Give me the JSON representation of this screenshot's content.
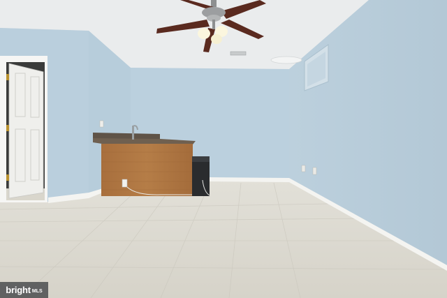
{
  "photo": {
    "colors": {
      "wall": "#b9cfdd",
      "ceiling": "#e9ecec",
      "floor": "#d8d6cc",
      "door": "#f1f1ee",
      "counter_wood": "#b07842",
      "countertop": "#6b5a4a",
      "baseboard": "#f4f4f2",
      "fan_blade": "#5a2a1f"
    }
  },
  "watermark": {
    "brand": "bright",
    "suffix": "MLS"
  }
}
